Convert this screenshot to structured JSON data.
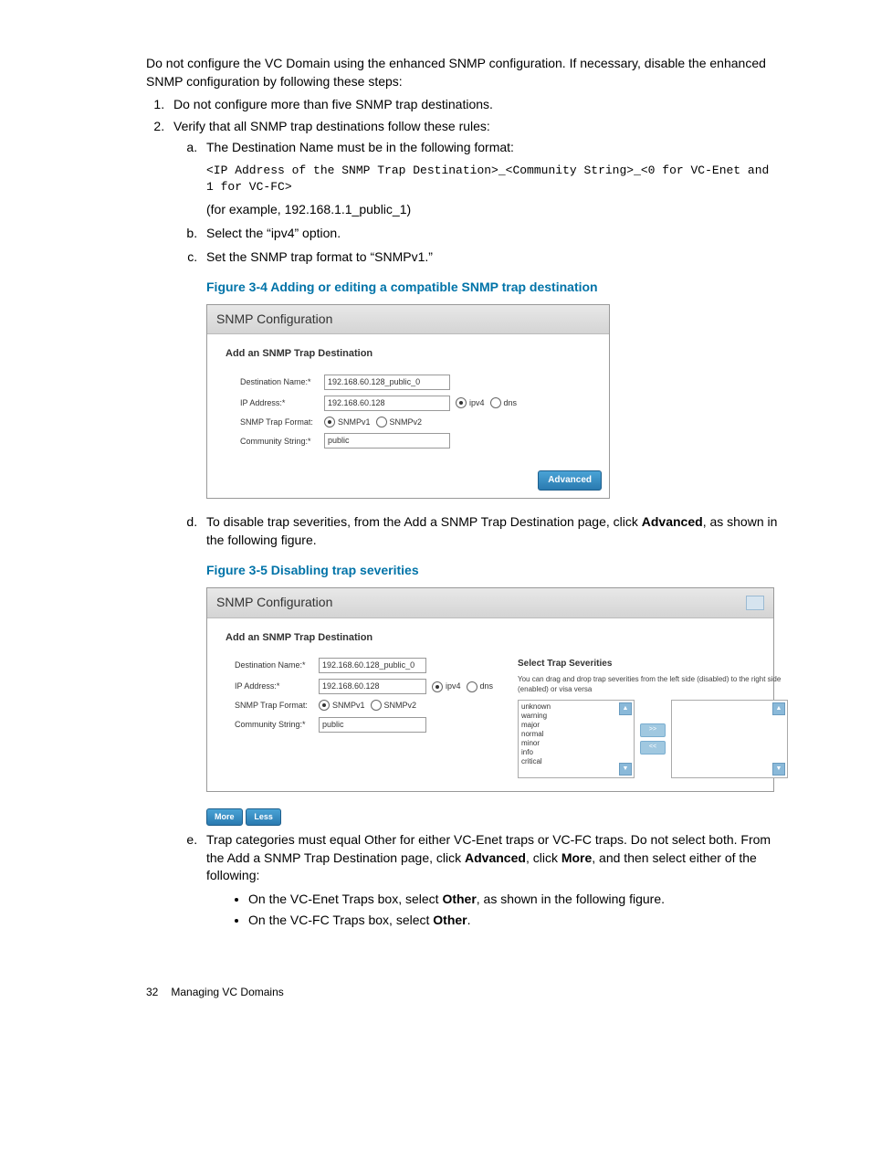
{
  "intro": "Do not configure the VC Domain using the enhanced SNMP configuration. If necessary, disable the enhanced SNMP configuration by following these steps:",
  "steps": {
    "s1": "Do not configure more than five SNMP trap destinations.",
    "s2": "Verify that all SNMP trap destinations follow these rules:",
    "a": "The Destination Name must be in the following format:",
    "code": "<IP Address of the SNMP Trap Destination>_<Community String>_<0 for VC-Enet and 1 for VC-FC>",
    "example": "(for example, 192.168.1.1_public_1)",
    "b": "Select the “ipv4” option.",
    "c": "Set the SNMP trap format to “SNMPv1.”",
    "d_pre": "To disable trap severities, from the Add a SNMP Trap Destination page, click ",
    "d_bold": "Advanced",
    "d_post": ", as shown in the following figure.",
    "e_pre": "Trap categories must equal Other for either VC-Enet traps or VC-FC traps. Do not select both. From the Add a SNMP Trap Destination page, click ",
    "e_b1": "Advanced",
    "e_mid1": ", click ",
    "e_b2": "More",
    "e_post": ", and then select either of the following:",
    "bullet1_pre": "On the VC-Enet Traps box, select ",
    "bullet1_bold": "Other",
    "bullet1_post": ", as shown in the following figure.",
    "bullet2_pre": "On the VC-FC Traps box, select ",
    "bullet2_bold": "Other",
    "bullet2_post": "."
  },
  "fig34_caption": "Figure 3-4 Adding or editing a compatible SNMP trap destination",
  "fig35_caption": "Figure 3-5 Disabling trap severities",
  "fig1": {
    "title": "SNMP Configuration",
    "section": "Add an SNMP Trap Destination",
    "labels": {
      "dest": "Destination Name:*",
      "ip": "IP Address:*",
      "fmt": "SNMP Trap Format:",
      "comm": "Community String:*"
    },
    "values": {
      "dest": "192.168.60.128_public_0",
      "ip": "192.168.60.128",
      "comm": "public"
    },
    "radios": {
      "ipv4": "ipv4",
      "dns": "dns",
      "v1": "SNMPv1",
      "v2": "SNMPv2"
    },
    "adv_btn": "Advanced"
  },
  "fig2": {
    "title": "SNMP Configuration",
    "section": "Add an SNMP Trap Destination",
    "labels": {
      "dest": "Destination Name:*",
      "ip": "IP Address:*",
      "fmt": "SNMP Trap Format:",
      "comm": "Community String:*"
    },
    "values": {
      "dest": "192.168.60.128_public_0",
      "ip": "192.168.60.128",
      "comm": "public"
    },
    "radios": {
      "ipv4": "ipv4",
      "dns": "dns",
      "v1": "SNMPv1",
      "v2": "SNMPv2"
    },
    "sev_title": "Select Trap Severities",
    "sev_hint": "You can drag and drop trap severities from the left side (disabled) to the right side (enabled) or visa versa",
    "sev_items": [
      "unknown",
      "warning",
      "major",
      "normal",
      "minor",
      "info",
      "critical"
    ],
    "more_btn": "More",
    "less_btn": "Less"
  },
  "footer": {
    "page": "32",
    "chapter": "Managing VC Domains"
  }
}
